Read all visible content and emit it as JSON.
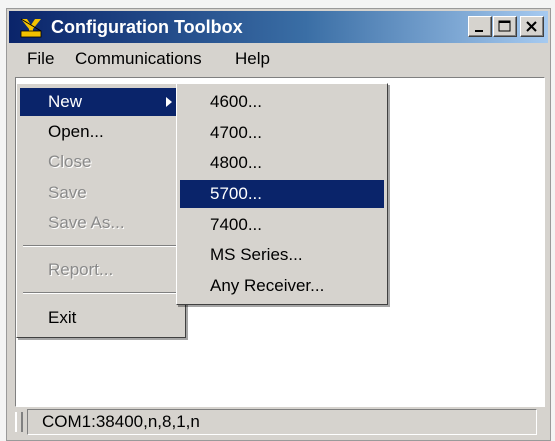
{
  "window": {
    "title": "Configuration Toolbox",
    "controls": [
      "minimize",
      "maximize",
      "close"
    ]
  },
  "menubar": {
    "items": [
      "File",
      "Communications",
      "Help"
    ]
  },
  "file_menu": {
    "items": [
      {
        "label": "New",
        "state": "selected",
        "has_submenu": true
      },
      {
        "label": "Open...",
        "state": "enabled"
      },
      {
        "label": "Close",
        "state": "disabled"
      },
      {
        "label": "Save",
        "state": "disabled"
      },
      {
        "label": "Save As...",
        "state": "disabled"
      },
      {
        "label": "Report...",
        "state": "disabled"
      },
      {
        "label": "Exit",
        "state": "enabled"
      }
    ]
  },
  "new_submenu": {
    "items": [
      {
        "label": "4600...",
        "state": "enabled"
      },
      {
        "label": "4700...",
        "state": "enabled"
      },
      {
        "label": "4800...",
        "state": "enabled"
      },
      {
        "label": "5700...",
        "state": "selected"
      },
      {
        "label": "7400...",
        "state": "enabled"
      },
      {
        "label": "MS Series...",
        "state": "enabled"
      },
      {
        "label": "Any Receiver...",
        "state": "enabled"
      }
    ]
  },
  "statusbar": {
    "text": "COM1:38400,n,8,1,n"
  },
  "icons": {
    "app": "trimble-toolbox-icon",
    "minimize": "minimize-icon",
    "maximize": "maximize-icon",
    "close": "close-icon",
    "submenu_arrow": "chevron-right-icon"
  },
  "colors": {
    "title_gradient_start": "#0a246a",
    "title_gradient_end": "#a6caf0",
    "selection": "#0a246a",
    "face": "#d6d3ce"
  }
}
